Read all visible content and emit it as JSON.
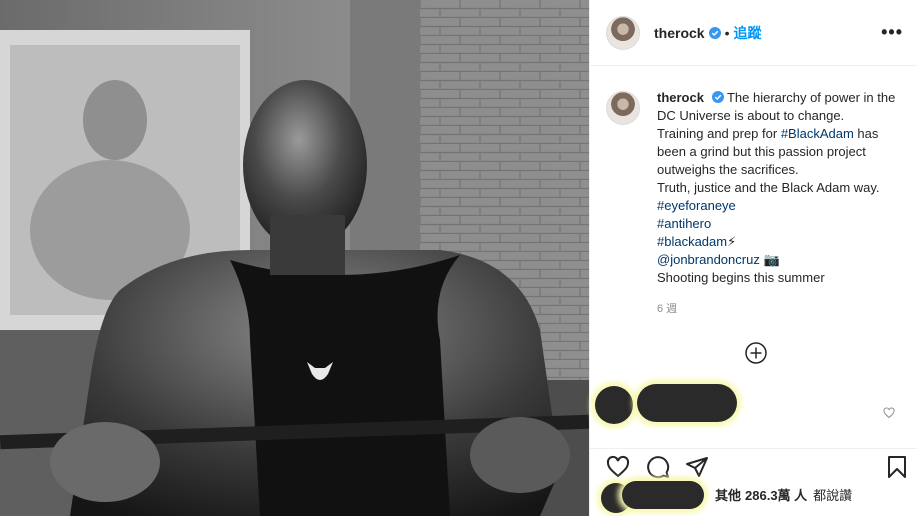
{
  "post": {
    "username": "therock",
    "follow_label": "追蹤",
    "separator": "•",
    "more_label": "•••"
  },
  "caption": {
    "username": "therock",
    "lines": [
      "The hierarchy of power in the DC Universe is about to change.",
      "Training and prep for ",
      "#BlackAdam",
      " has been a grind but this passion project outweighs the sacrifices.",
      "Truth, justice and the Black Adam way.",
      "#eyeforaneye",
      "#antihero",
      "#blackadam",
      "⚡",
      "@jonbrandoncruz",
      "📷",
      "Shooting begins this summer"
    ],
    "time": "6 週"
  },
  "likes": {
    "prefix": "其他",
    "count": "286.3萬 人",
    "suffix": "都說讚"
  },
  "icons": {
    "verified": "verified-badge-icon",
    "more": "more-options-icon",
    "load_more": "plus-circle-icon",
    "like": "heart-icon",
    "comment": "comment-bubble-icon",
    "share": "paper-plane-icon",
    "save": "bookmark-icon"
  },
  "colors": {
    "link": "#00376b",
    "follow": "#0095f6",
    "verified": "#3897f0",
    "muted": "#8e8e8e"
  }
}
